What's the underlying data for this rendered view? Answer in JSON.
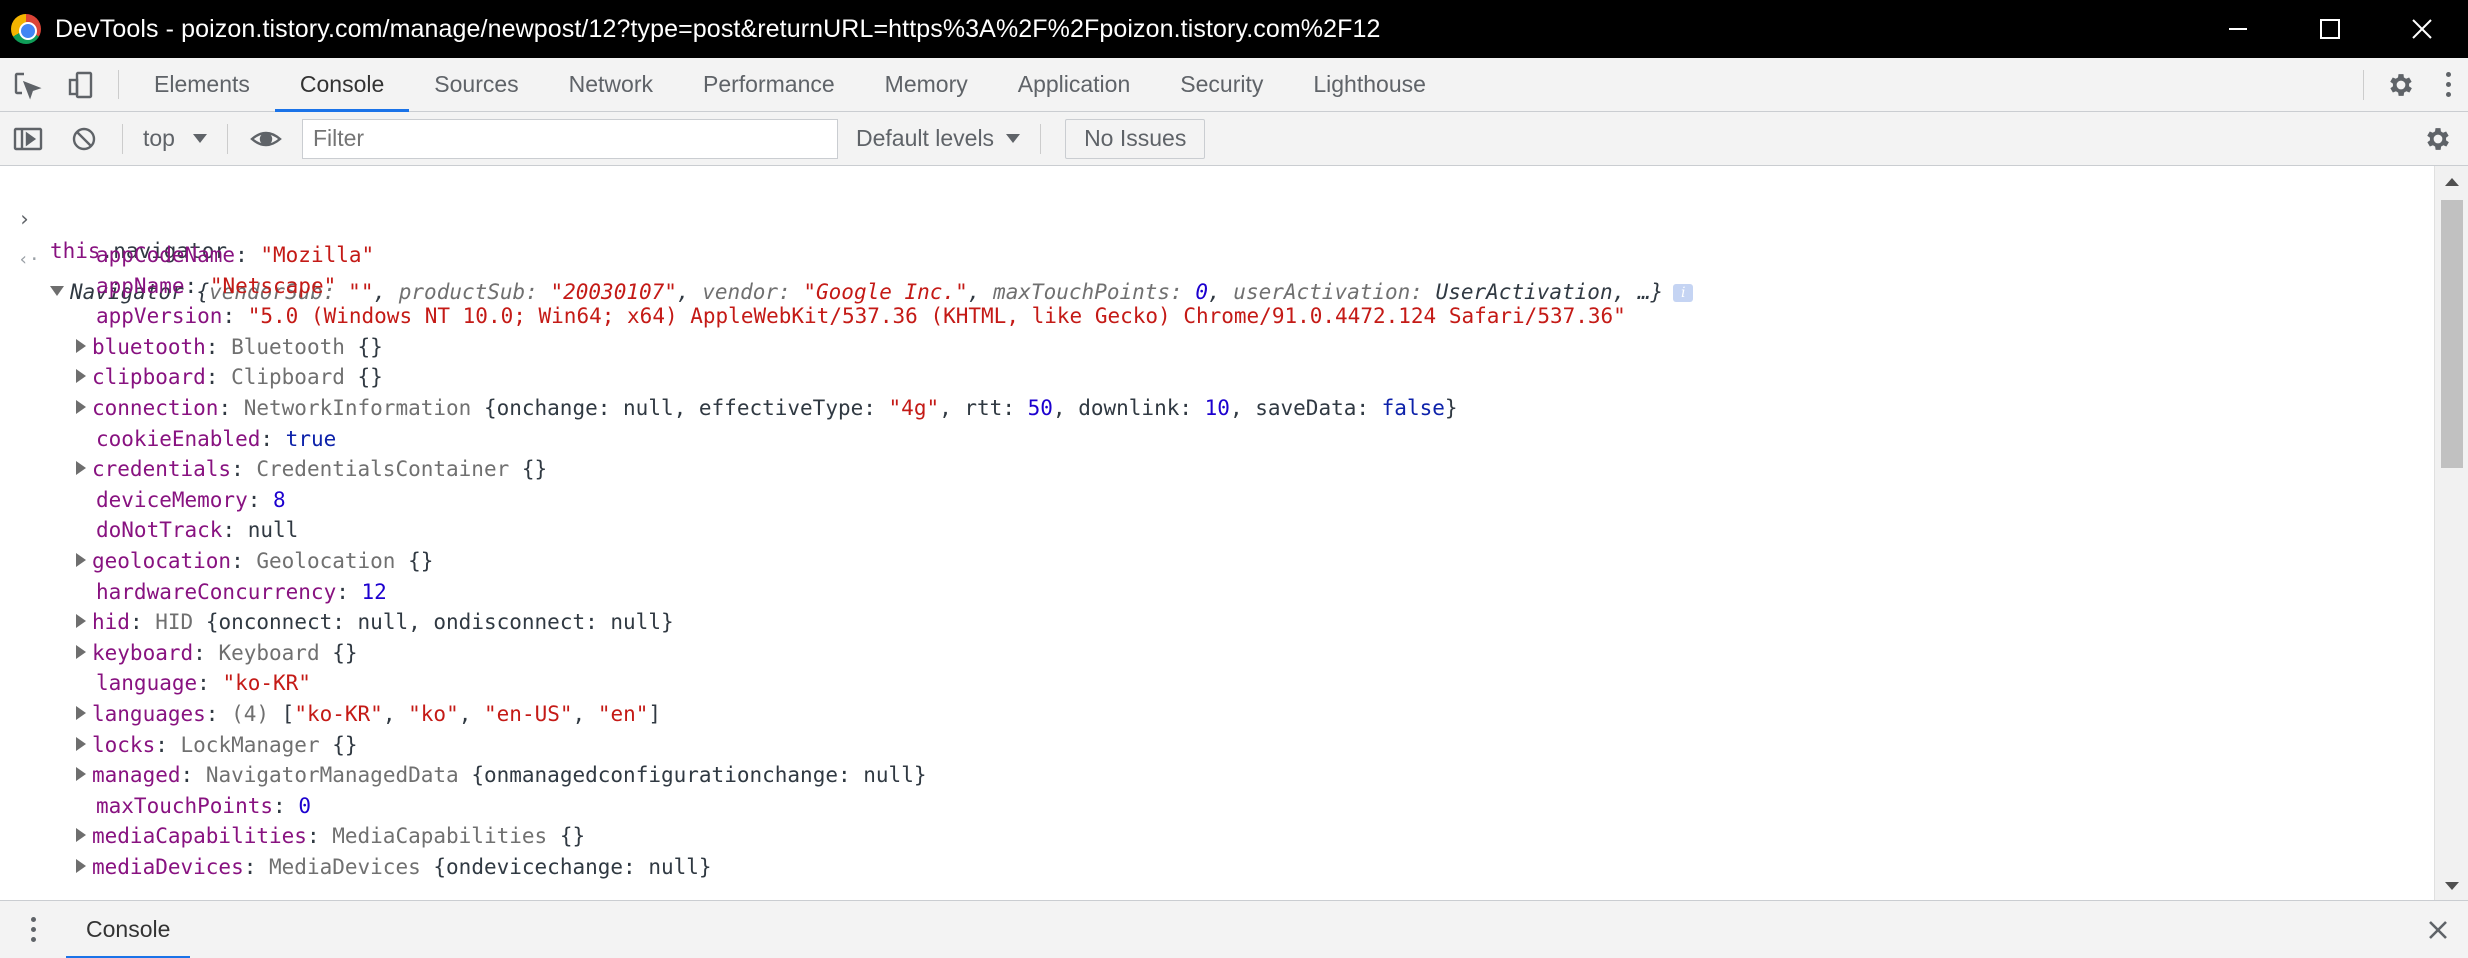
{
  "window": {
    "title": "DevTools - poizon.tistory.com/manage/newpost/12?type=post&returnURL=https%3A%2F%2Fpoizon.tistory.com%2F12"
  },
  "tabs": [
    {
      "label": "Elements"
    },
    {
      "label": "Console"
    },
    {
      "label": "Sources"
    },
    {
      "label": "Network"
    },
    {
      "label": "Performance"
    },
    {
      "label": "Memory"
    },
    {
      "label": "Application"
    },
    {
      "label": "Security"
    },
    {
      "label": "Lighthouse"
    }
  ],
  "toolbar": {
    "context": "top",
    "filter_placeholder": "Filter",
    "levels": "Default levels",
    "issues": "No Issues"
  },
  "console": {
    "input": "this.navigator",
    "summary": {
      "class": "Navigator",
      "text_open": " {",
      "fields": [
        {
          "key": "vendorSub",
          "value": "\"\"",
          "type": "str"
        },
        {
          "key": "productSub",
          "value": "\"20030107\"",
          "type": "str"
        },
        {
          "key": "vendor",
          "value": "\"Google Inc.\"",
          "type": "str"
        },
        {
          "key": "maxTouchPoints",
          "value": "0",
          "type": "num"
        },
        {
          "key": "userActivation",
          "value": "UserActivation",
          "type": "plain"
        }
      ],
      "text_close": ", …}"
    },
    "properties": [
      {
        "name": "appCodeName",
        "expandable": false,
        "parts": [
          {
            "t": "str",
            "v": "\"Mozilla\""
          }
        ]
      },
      {
        "name": "appName",
        "expandable": false,
        "parts": [
          {
            "t": "str",
            "v": "\"Netscape\""
          }
        ]
      },
      {
        "name": "appVersion",
        "expandable": false,
        "parts": [
          {
            "t": "str",
            "v": "\"5.0 (Windows NT 10.0; Win64; x64) AppleWebKit/537.36 (KHTML, like Gecko) Chrome/91.0.4472.124 Safari/537.36\""
          }
        ]
      },
      {
        "name": "bluetooth",
        "expandable": true,
        "parts": [
          {
            "t": "ctor",
            "v": "Bluetooth "
          },
          {
            "t": "plain",
            "v": "{}"
          }
        ]
      },
      {
        "name": "clipboard",
        "expandable": true,
        "parts": [
          {
            "t": "ctor",
            "v": "Clipboard "
          },
          {
            "t": "plain",
            "v": "{}"
          }
        ]
      },
      {
        "name": "connection",
        "expandable": true,
        "parts": [
          {
            "t": "ctor",
            "v": "NetworkInformation "
          },
          {
            "t": "plain",
            "v": "{onchange: null, effectiveType: "
          },
          {
            "t": "str",
            "v": "\"4g\""
          },
          {
            "t": "plain",
            "v": ", rtt: "
          },
          {
            "t": "num",
            "v": "50"
          },
          {
            "t": "plain",
            "v": ", downlink: "
          },
          {
            "t": "num",
            "v": "10"
          },
          {
            "t": "plain",
            "v": ", saveData: "
          },
          {
            "t": "kw",
            "v": "false"
          },
          {
            "t": "plain",
            "v": "}"
          }
        ]
      },
      {
        "name": "cookieEnabled",
        "expandable": false,
        "parts": [
          {
            "t": "kw",
            "v": "true"
          }
        ]
      },
      {
        "name": "credentials",
        "expandable": true,
        "parts": [
          {
            "t": "ctor",
            "v": "CredentialsContainer "
          },
          {
            "t": "plain",
            "v": "{}"
          }
        ]
      },
      {
        "name": "deviceMemory",
        "expandable": false,
        "parts": [
          {
            "t": "num",
            "v": "8"
          }
        ]
      },
      {
        "name": "doNotTrack",
        "expandable": false,
        "parts": [
          {
            "t": "plain",
            "v": "null"
          }
        ]
      },
      {
        "name": "geolocation",
        "expandable": true,
        "parts": [
          {
            "t": "ctor",
            "v": "Geolocation "
          },
          {
            "t": "plain",
            "v": "{}"
          }
        ]
      },
      {
        "name": "hardwareConcurrency",
        "expandable": false,
        "parts": [
          {
            "t": "num",
            "v": "12"
          }
        ]
      },
      {
        "name": "hid",
        "expandable": true,
        "parts": [
          {
            "t": "ctor",
            "v": "HID "
          },
          {
            "t": "plain",
            "v": "{onconnect: null, ondisconnect: null}"
          }
        ]
      },
      {
        "name": "keyboard",
        "expandable": true,
        "parts": [
          {
            "t": "ctor",
            "v": "Keyboard "
          },
          {
            "t": "plain",
            "v": "{}"
          }
        ]
      },
      {
        "name": "language",
        "expandable": false,
        "parts": [
          {
            "t": "str",
            "v": "\"ko-KR\""
          }
        ]
      },
      {
        "name": "languages",
        "expandable": true,
        "parts": [
          {
            "t": "ctor",
            "v": "(4) "
          },
          {
            "t": "plain",
            "v": "["
          },
          {
            "t": "str",
            "v": "\"ko-KR\""
          },
          {
            "t": "plain",
            "v": ", "
          },
          {
            "t": "str",
            "v": "\"ko\""
          },
          {
            "t": "plain",
            "v": ", "
          },
          {
            "t": "str",
            "v": "\"en-US\""
          },
          {
            "t": "plain",
            "v": ", "
          },
          {
            "t": "str",
            "v": "\"en\""
          },
          {
            "t": "plain",
            "v": "]"
          }
        ]
      },
      {
        "name": "locks",
        "expandable": true,
        "parts": [
          {
            "t": "ctor",
            "v": "LockManager "
          },
          {
            "t": "plain",
            "v": "{}"
          }
        ]
      },
      {
        "name": "managed",
        "expandable": true,
        "parts": [
          {
            "t": "ctor",
            "v": "NavigatorManagedData "
          },
          {
            "t": "plain",
            "v": "{onmanagedconfigurationchange: null}"
          }
        ]
      },
      {
        "name": "maxTouchPoints",
        "expandable": false,
        "parts": [
          {
            "t": "num",
            "v": "0"
          }
        ]
      },
      {
        "name": "mediaCapabilities",
        "expandable": true,
        "parts": [
          {
            "t": "ctor",
            "v": "MediaCapabilities "
          },
          {
            "t": "plain",
            "v": "{}"
          }
        ]
      },
      {
        "name": "mediaDevices",
        "expandable": true,
        "parts": [
          {
            "t": "ctor",
            "v": "MediaDevices "
          },
          {
            "t": "plain",
            "v": "{ondevicechange: null}"
          }
        ]
      }
    ]
  },
  "drawer": {
    "tab": "Console"
  },
  "icons": {
    "inspect": "inspect-element-icon",
    "device": "device-toolbar-icon",
    "sidebar": "show-sidebar-icon",
    "clear": "clear-console-icon",
    "eye": "live-expression-icon",
    "settings": "gear-icon",
    "more": "more-options-icon",
    "close": "close-icon"
  },
  "colors": {
    "accent": "#1a73e8",
    "property": "#881280",
    "string": "#c41a16",
    "number": "#1c00cf"
  }
}
